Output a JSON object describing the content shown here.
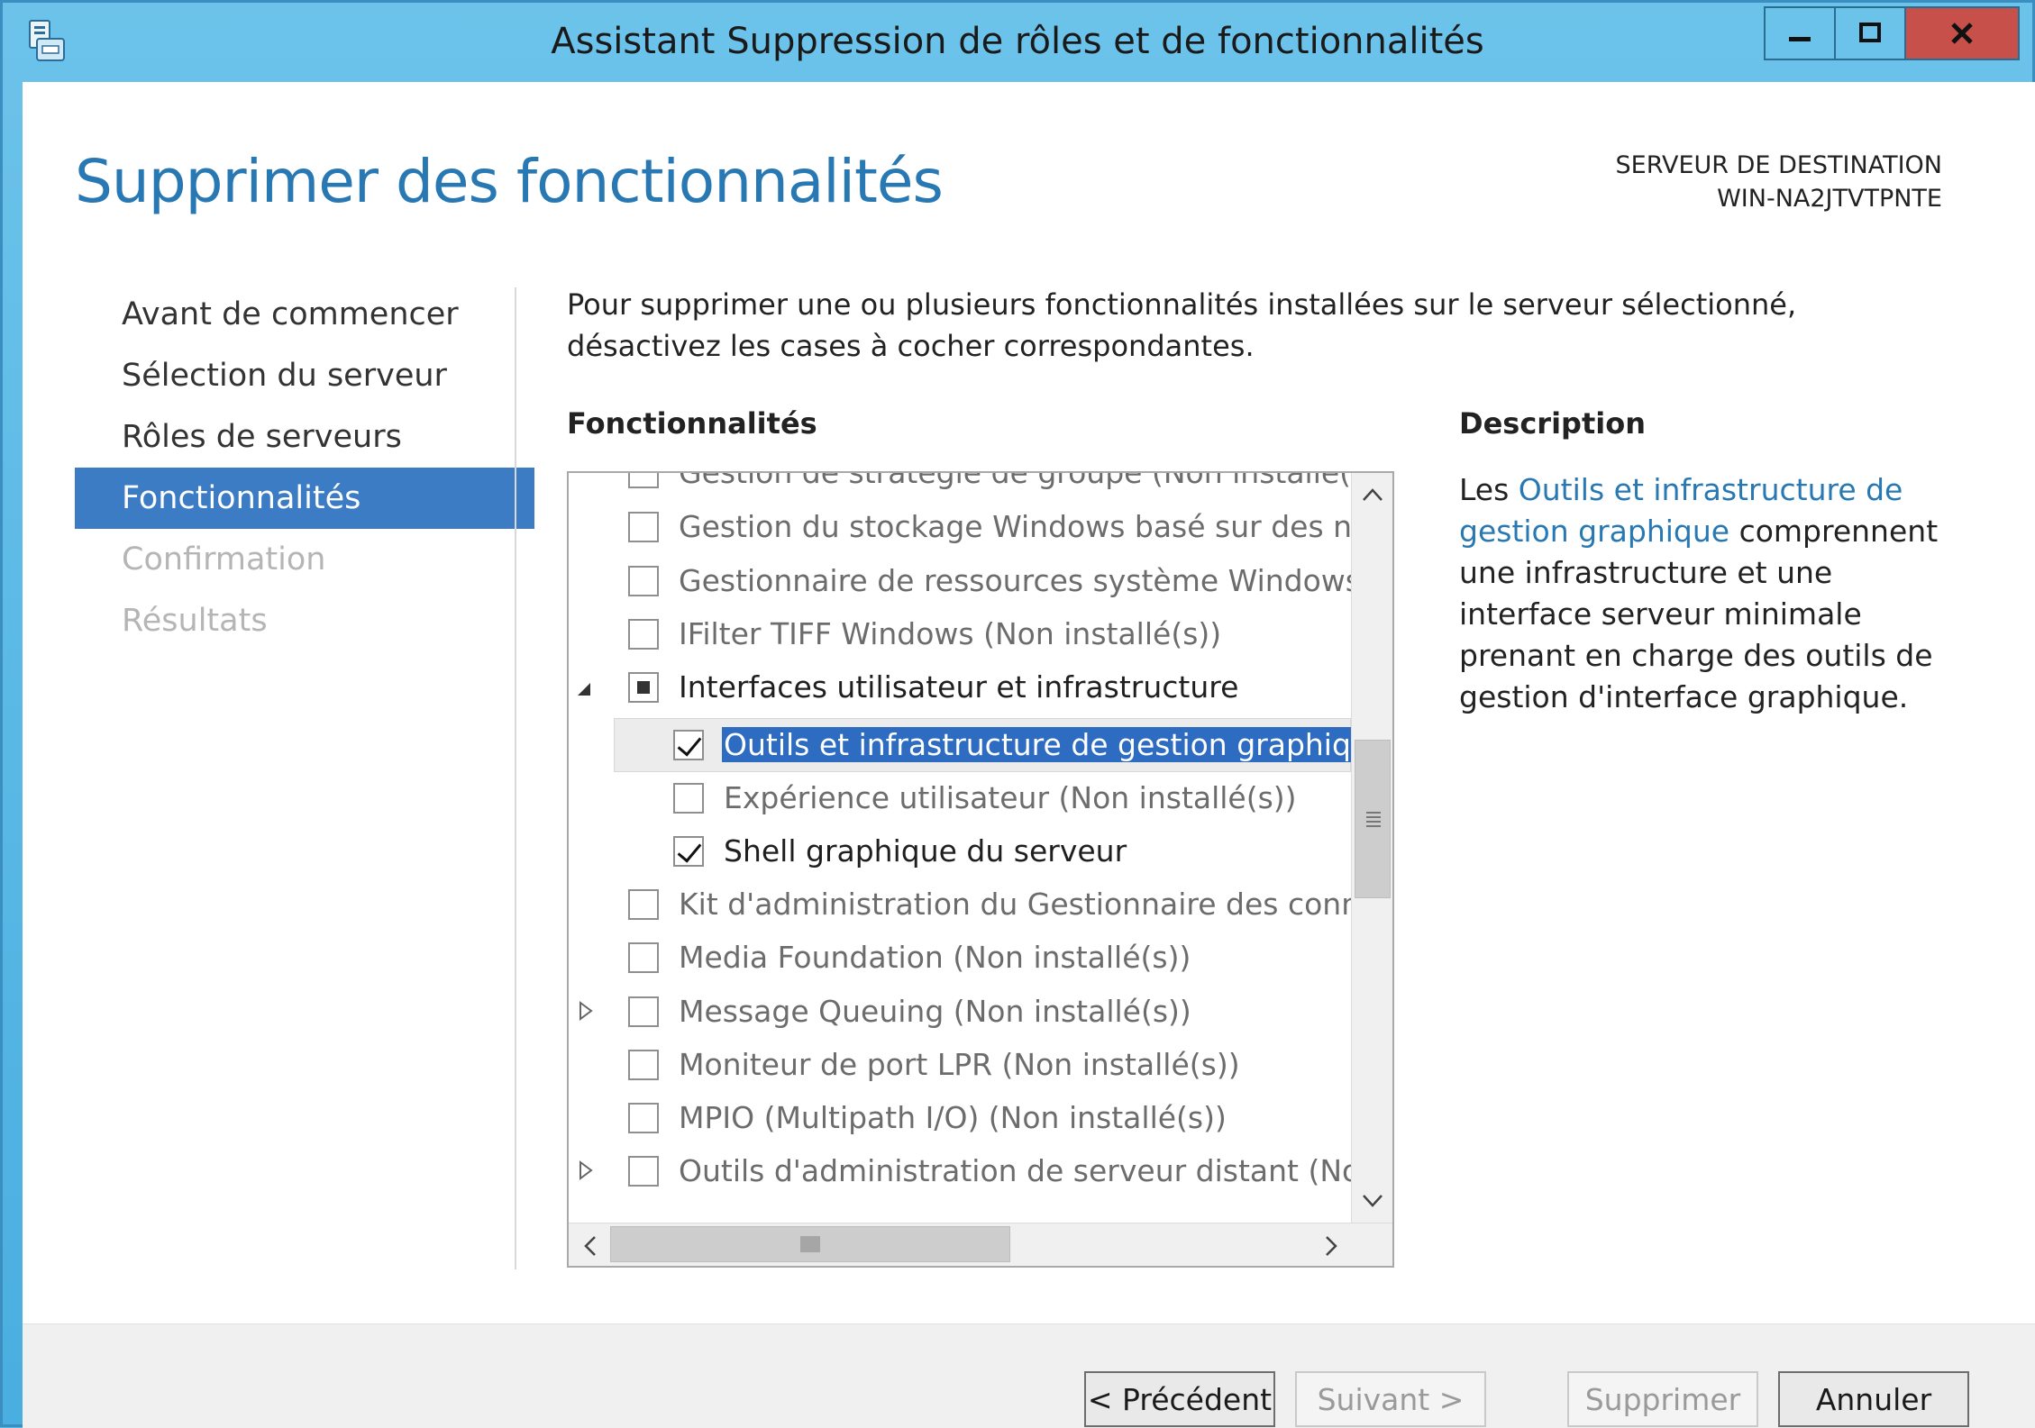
{
  "window": {
    "title": "Assistant Suppression de rôles et de fonctionnalités"
  },
  "header": {
    "page_title": "Supprimer des fonctionnalités",
    "destination_label": "SERVEUR DE DESTINATION",
    "destination_server": "WIN-NA2JTVTPNTE"
  },
  "nav": {
    "items": [
      {
        "label": "Avant de commencer",
        "state": "normal"
      },
      {
        "label": "Sélection du serveur",
        "state": "normal"
      },
      {
        "label": "Rôles de serveurs",
        "state": "normal"
      },
      {
        "label": "Fonctionnalités",
        "state": "active"
      },
      {
        "label": "Confirmation",
        "state": "disabled"
      },
      {
        "label": "Résultats",
        "state": "disabled"
      }
    ]
  },
  "main": {
    "intro": "Pour supprimer une ou plusieurs fonctionnalités installées sur le serveur sélectionné, désactivez les cases à cocher correspondantes.",
    "features_heading": "Fonctionnalités",
    "features": [
      {
        "label": "Gestion de stratégie de groupe (Non installé(s))",
        "checked": false,
        "level": 0
      },
      {
        "label": "Gestion du stockage Windows basé sur des normes",
        "checked": false,
        "level": 0
      },
      {
        "label": "Gestionnaire de ressources système Windows (déc",
        "checked": false,
        "level": 0
      },
      {
        "label": "IFilter TIFF Windows (Non installé(s))",
        "checked": false,
        "level": 0
      },
      {
        "label": "Interfaces utilisateur et infrastructure",
        "checked": "partial",
        "level": 0,
        "expander": "expanded"
      },
      {
        "label": "Outils et infrastructure de gestion graphique",
        "checked": true,
        "level": 1,
        "selected": true
      },
      {
        "label": "Expérience utilisateur (Non installé(s))",
        "checked": false,
        "level": 1
      },
      {
        "label": "Shell graphique du serveur",
        "checked": true,
        "level": 1
      },
      {
        "label": "Kit d'administration du Gestionnaire des connexio",
        "checked": false,
        "level": 0
      },
      {
        "label": "Media Foundation (Non installé(s))",
        "checked": false,
        "level": 0
      },
      {
        "label": "Message Queuing (Non installé(s))",
        "checked": false,
        "level": 0,
        "expander": "collapsed"
      },
      {
        "label": "Moniteur de port LPR (Non installé(s))",
        "checked": false,
        "level": 0
      },
      {
        "label": "MPIO (Multipath I/O) (Non installé(s))",
        "checked": false,
        "level": 0
      },
      {
        "label": "Outils d'administration de serveur distant (Non ins",
        "checked": false,
        "level": 0,
        "expander": "collapsed"
      }
    ],
    "description_heading": "Description",
    "description_prefix": "Les ",
    "description_link": "Outils et infrastructure de gestion graphique",
    "description_suffix": " comprennent une infrastructure et une interface serveur minimale prenant en charge des outils de gestion d'interface graphique."
  },
  "footer": {
    "previous": "< Précédent",
    "next": "Suivant >",
    "remove": "Supprimer",
    "cancel": "Annuler"
  },
  "colors": {
    "accent": "#3c7cc4",
    "title_blue": "#2878b4",
    "titlebar": "#5bb8e6",
    "close": "#c7504a"
  }
}
